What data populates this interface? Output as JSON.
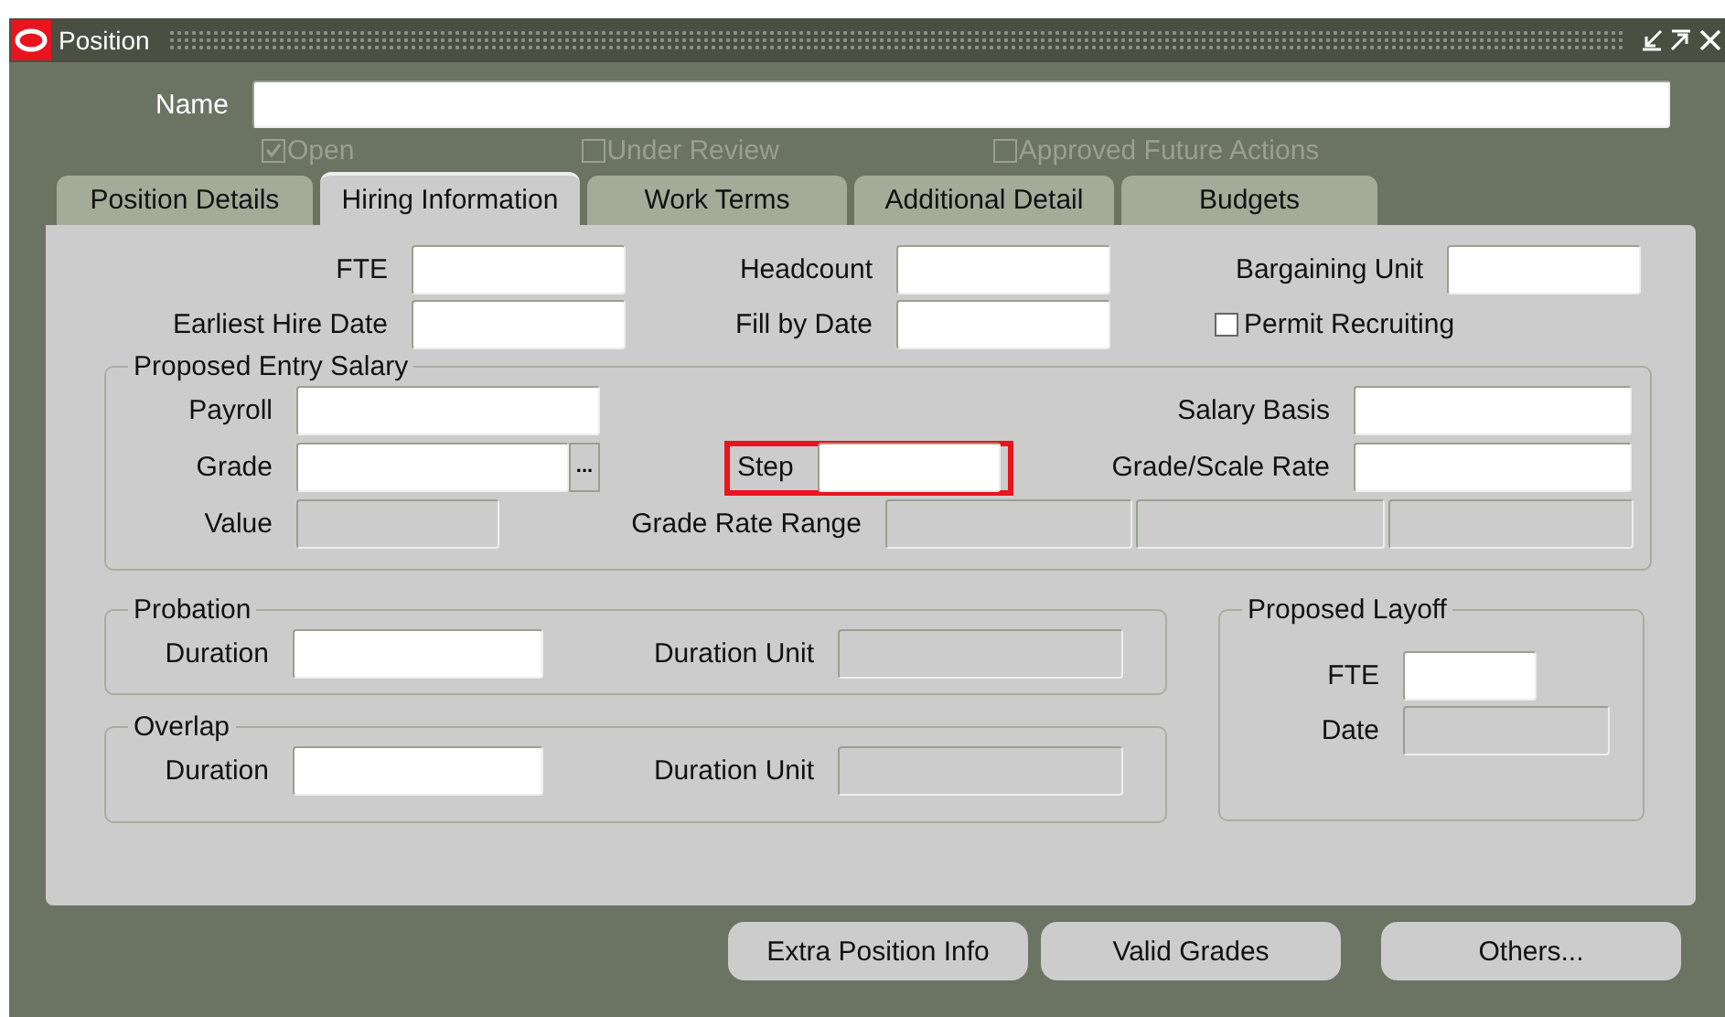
{
  "window": {
    "title": "Position"
  },
  "name_field": {
    "label": "Name"
  },
  "status_flags": [
    {
      "label": "Open",
      "checked": true
    },
    {
      "label": "Under Review",
      "checked": false
    },
    {
      "label": "Approved Future Actions",
      "checked": false
    }
  ],
  "tabs": [
    {
      "label": "Position Details",
      "selected": false
    },
    {
      "label": "Hiring Information",
      "selected": true
    },
    {
      "label": "Work Terms",
      "selected": false
    },
    {
      "label": "Additional Detail",
      "selected": false
    },
    {
      "label": "Budgets",
      "selected": false
    }
  ],
  "hiring": {
    "fte": {
      "label": "FTE"
    },
    "headcount": {
      "label": "Headcount"
    },
    "bargaining_unit": {
      "label": "Bargaining Unit"
    },
    "earliest_hire_date": {
      "label": "Earliest Hire Date"
    },
    "fill_by_date": {
      "label": "Fill by Date"
    },
    "permit_recruiting": {
      "label": "Permit Recruiting",
      "checked": false
    }
  },
  "proposed_entry_salary": {
    "title": "Proposed Entry Salary",
    "payroll": {
      "label": "Payroll",
      "disabled": false
    },
    "salary_basis": {
      "label": "Salary Basis",
      "disabled": false
    },
    "grade": {
      "label": "Grade",
      "disabled": false,
      "lov_button": "..."
    },
    "step": {
      "label": "Step",
      "disabled": false,
      "highlighted": true
    },
    "grade_scale_rate": {
      "label": "Grade/Scale Rate",
      "disabled": false
    },
    "value": {
      "label": "Value",
      "disabled": true
    },
    "grade_rate_range": {
      "label": "Grade Rate Range",
      "disabled": true
    }
  },
  "probation": {
    "title": "Probation",
    "duration": {
      "label": "Duration",
      "disabled": false
    },
    "duration_unit": {
      "label": "Duration Unit",
      "disabled": true
    }
  },
  "overlap": {
    "title": "Overlap",
    "duration": {
      "label": "Duration",
      "disabled": false
    },
    "duration_unit": {
      "label": "Duration Unit",
      "disabled": true
    }
  },
  "proposed_layoff": {
    "title": "Proposed Layoff",
    "fte": {
      "label": "FTE",
      "disabled": false
    },
    "date": {
      "label": "Date",
      "disabled": true
    }
  },
  "buttons": [
    "Extra Position Info",
    "Valid Grades",
    "Others..."
  ]
}
